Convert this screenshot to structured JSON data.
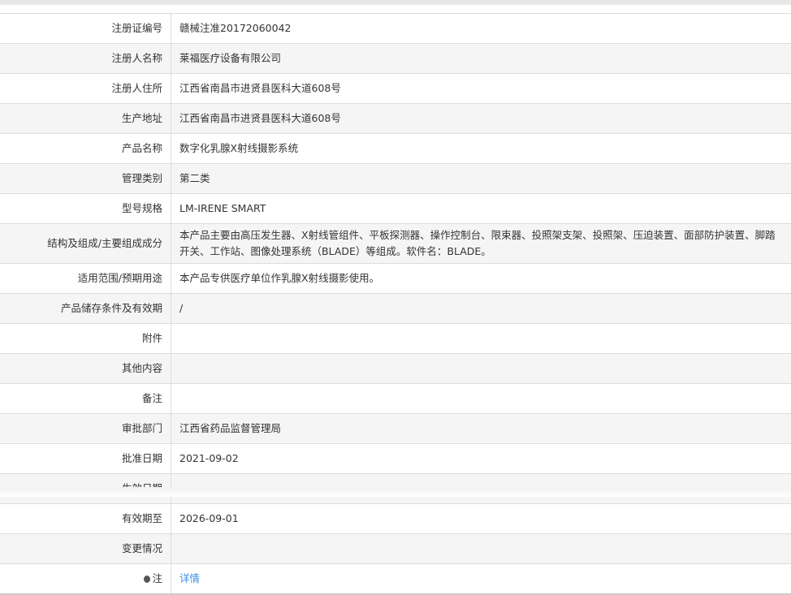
{
  "rows": [
    {
      "label": "注册证编号",
      "value": "赣械注准20172060042"
    },
    {
      "label": "注册人名称",
      "value": "莱福医疗设备有限公司"
    },
    {
      "label": "注册人住所",
      "value": "江西省南昌市进贤县医科大道608号"
    },
    {
      "label": "生产地址",
      "value": "江西省南昌市进贤县医科大道608号"
    },
    {
      "label": "产品名称",
      "value": "数字化乳腺X射线摄影系统"
    },
    {
      "label": "管理类别",
      "value": "第二类"
    },
    {
      "label": "型号规格",
      "value": "LM-IRENE SMART"
    },
    {
      "label": "结构及组成/主要组成成分",
      "value": "本产品主要由高压发生器、X射线管组件、平板探测器、操作控制台、限束器、投照架支架、投照架、压迫装置、面部防护装置、脚踏开关、工作站、图像处理系统（BLADE）等组成。软件名：BLADE。"
    },
    {
      "label": "适用范围/预期用途",
      "value": "本产品专供医疗单位作乳腺X射线摄影使用。"
    },
    {
      "label": "产品储存条件及有效期",
      "value": "/"
    },
    {
      "label": "附件",
      "value": ""
    },
    {
      "label": "其他内容",
      "value": ""
    },
    {
      "label": "备注",
      "value": ""
    },
    {
      "label": "审批部门",
      "value": "江西省药品监督管理局"
    },
    {
      "label": "批准日期",
      "value": "2021-09-02"
    },
    {
      "label": "生效日期",
      "value": ""
    },
    {
      "label": "有效期至",
      "value": "2026-09-01"
    },
    {
      "label": "变更情况",
      "value": ""
    }
  ],
  "note": {
    "label": "注",
    "link": "详情",
    "icon": "lightbulb-icon"
  }
}
